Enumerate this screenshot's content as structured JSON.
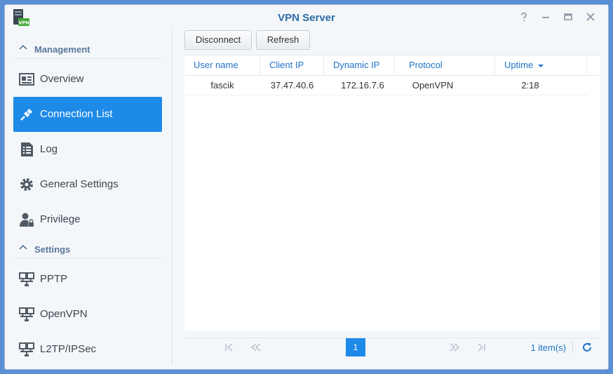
{
  "window": {
    "title": "VPN Server"
  },
  "sidebar": {
    "sections": [
      {
        "label": "Management"
      },
      {
        "label": "Settings"
      }
    ],
    "items": [
      {
        "label": "Overview"
      },
      {
        "label": "Connection List"
      },
      {
        "label": "Log"
      },
      {
        "label": "General Settings"
      },
      {
        "label": "Privilege"
      },
      {
        "label": "PPTP"
      },
      {
        "label": "OpenVPN"
      },
      {
        "label": "L2TP/IPSec"
      }
    ]
  },
  "toolbar": {
    "disconnect_label": "Disconnect",
    "refresh_label": "Refresh"
  },
  "table": {
    "columns": [
      "User name",
      "Client IP",
      "Dynamic IP",
      "Protocol",
      "Uptime"
    ],
    "rows": [
      {
        "user": "fascik",
        "client_ip": "37.47.40.6",
        "dynamic_ip": "172.16.7.6",
        "protocol": "OpenVPN",
        "uptime": "2:18"
      }
    ]
  },
  "pager": {
    "page": "1",
    "count": "1 item(s)"
  },
  "colors": {
    "accent": "#1e8ae8",
    "link": "#1e73c7",
    "title": "#2f6ba7"
  }
}
